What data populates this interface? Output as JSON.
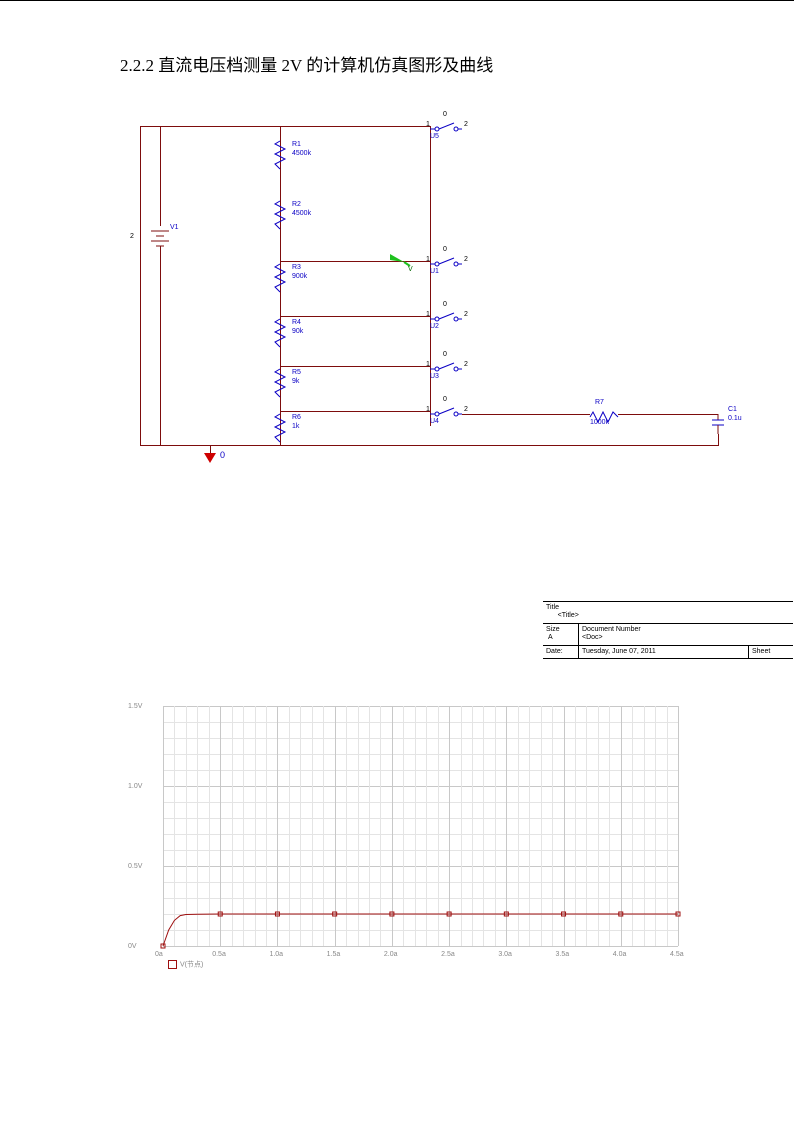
{
  "heading": "2.2.2 直流电压档测量 2V 的计算机仿真图形及曲线",
  "source": {
    "ref": "V1",
    "value": "2"
  },
  "resistors": [
    {
      "ref": "R1",
      "value": "4500k"
    },
    {
      "ref": "R2",
      "value": "4500k"
    },
    {
      "ref": "R3",
      "value": "900k"
    },
    {
      "ref": "R4",
      "value": "90k"
    },
    {
      "ref": "R5",
      "value": "9k"
    },
    {
      "ref": "R6",
      "value": "1k"
    },
    {
      "ref": "R7",
      "value": "1000k"
    }
  ],
  "switches": [
    {
      "ref": "U5"
    },
    {
      "ref": "U1"
    },
    {
      "ref": "U2"
    },
    {
      "ref": "U3"
    },
    {
      "ref": "U4"
    }
  ],
  "switch_pins": {
    "top": "0",
    "left": "1",
    "right": "2"
  },
  "cap": {
    "ref": "C1",
    "value": "0.1u"
  },
  "gnd_label": "0",
  "probe_label": "V",
  "title_block": {
    "title_hdr": "Title",
    "title": "<Title>",
    "size_hdr": "Size",
    "size": "A",
    "doc_hdr": "Document Number",
    "doc": "<Doc>",
    "date_hdr": "Date:",
    "date": "Tuesday, June 07, 2011",
    "sheet_hdr": "Sheet"
  },
  "chart_data": {
    "type": "line",
    "xlabel": "",
    "ylabel": "",
    "x_ticks": [
      "0a",
      "0.5a",
      "1.0a",
      "1.5a",
      "2.0a",
      "2.5a",
      "3.0a",
      "3.5a",
      "4.0a",
      "4.5a"
    ],
    "y_ticks": [
      "0V",
      "0.5V",
      "1.0V",
      "1.5V"
    ],
    "xlim": [
      0,
      4.5
    ],
    "ylim": [
      0,
      1.5
    ],
    "series": [
      {
        "name": "V(节点)",
        "x": [
          0,
          0.05,
          0.1,
          0.15,
          0.2,
          0.3,
          0.5,
          1.0,
          1.5,
          2.0,
          2.5,
          3.0,
          3.5,
          4.0,
          4.5
        ],
        "y": [
          0,
          0.1,
          0.16,
          0.19,
          0.197,
          0.199,
          0.2,
          0.2,
          0.2,
          0.2,
          0.2,
          0.2,
          0.2,
          0.2,
          0.2
        ]
      }
    ]
  }
}
